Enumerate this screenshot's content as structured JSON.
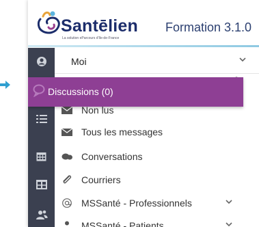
{
  "header": {
    "logo_text": "Santēlien",
    "tagline": "La solution eParcours d'Ile-de-France",
    "title": "Formation 3.1.0"
  },
  "user_selector": {
    "value": "Moi"
  },
  "highlight": {
    "label": "Discussions (0)"
  },
  "menu": {
    "items": [
      {
        "label": "Non lus",
        "icon": "envelope-icon"
      },
      {
        "label": "Tous les messages",
        "icon": "envelope-icon"
      },
      {
        "label": "Conversations",
        "icon": "chat-bubbles-icon"
      },
      {
        "label": "Courriers",
        "icon": "paperclip-icon"
      },
      {
        "label": "MSSanté - Professionnels",
        "icon": "at-icon"
      },
      {
        "label": "MSSanté - Patients",
        "icon": "person-icon"
      }
    ]
  },
  "sidebar": {
    "icons": [
      "user-circle-icon",
      "chat-bubble-icon",
      "checklist-icon",
      "calendar-icon",
      "table-icon",
      "users-icon"
    ]
  },
  "colors": {
    "sidebar": "#3b4050",
    "highlight": "#8e3f94",
    "pointer": "#2f9fd0",
    "brand": "#1c2d6b"
  }
}
